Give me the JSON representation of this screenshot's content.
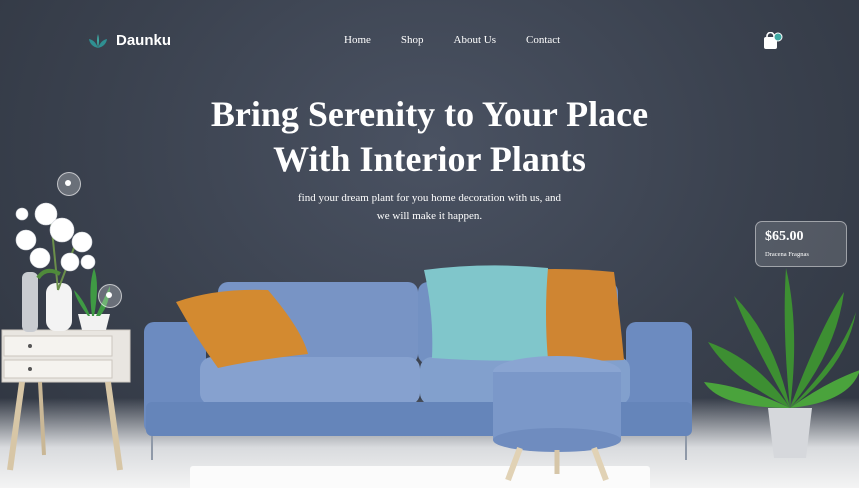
{
  "brand": {
    "name": "Daunku",
    "logo_icon": "lotus-leaf-icon",
    "accent": "#3fa9a3"
  },
  "nav": {
    "items": [
      "Home",
      "Shop",
      "About Us",
      "Contact"
    ]
  },
  "cart": {
    "icon": "shopping-bag-icon"
  },
  "hero": {
    "title_line1": "Bring Serenity to Your Place",
    "title_line2": "With Interior Plants",
    "subtitle_line1": "find your dream plant for you home decoration with us, and",
    "subtitle_line2": "we will make it happen."
  },
  "product_card": {
    "price": "$65.00",
    "name": "Dracena Fragnas"
  },
  "colors": {
    "wall": "#3a414e",
    "sofa": "#6f8fc2",
    "cushion_orange": "#d58a2f",
    "cushion_teal": "#7ec3c9",
    "plant": "#3d8f32"
  }
}
